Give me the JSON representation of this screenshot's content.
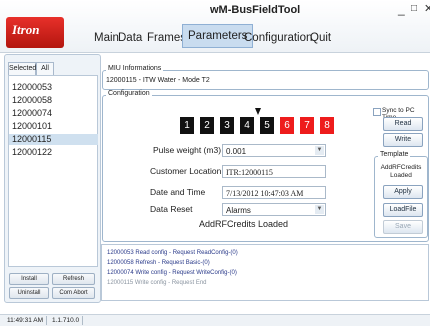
{
  "window": {
    "title": "wM-BusFieldTool",
    "minimize": "_",
    "maximize": "□",
    "close": "✕"
  },
  "brand": {
    "logo_text": "Itron"
  },
  "nav": {
    "items": [
      "Main",
      "Data",
      "Frames",
      "Parameters",
      "Configuration",
      "Quit"
    ],
    "active": "Parameters"
  },
  "left": {
    "tabs": [
      "Selected",
      "All"
    ],
    "devices": [
      "12000053",
      "12000058",
      "12000074",
      "12000101",
      "12000115",
      "12000122"
    ],
    "selected_device": "12000115",
    "buttons": {
      "install": "Install",
      "refresh": "Refresh",
      "uninstall": "Uninstall",
      "com_abort": "Com Abort"
    }
  },
  "miu": {
    "legend": "MIU Informations",
    "text": "12000115 - ITW Water - Mode T2"
  },
  "config": {
    "legend": "Configuration",
    "digits": [
      {
        "value": "1",
        "color": "#111111"
      },
      {
        "value": "2",
        "color": "#111111"
      },
      {
        "value": "3",
        "color": "#111111"
      },
      {
        "value": "4",
        "color": "#111111"
      },
      {
        "value": "5",
        "color": "#111111"
      },
      {
        "value": "6",
        "color": "#ee1c1c"
      },
      {
        "value": "7",
        "color": "#ee1c1c"
      },
      {
        "value": "8",
        "color": "#ee1c1c"
      }
    ],
    "pulse_weight_label": "Pulse weight (m3)",
    "pulse_weight_value": "0.001",
    "customer_location_label": "Customer Location",
    "customer_location_value": "ITR:12000115",
    "date_time_label": "Date and Time",
    "date_time_value": "7/13/2012 10:47:03 AM",
    "data_reset_label": "Data Reset",
    "data_reset_value": "Alarms",
    "status_message": "AddRFCredits  Loaded",
    "sync_label": "Sync to PC Time",
    "read_button": "Read",
    "write_button": "Write"
  },
  "template": {
    "legend": "Template",
    "status": "AddRFCredits Loaded",
    "apply_button": "Apply",
    "loadfile_button": "LoadFile",
    "save_button": "Save"
  },
  "log": [
    {
      "text": "12000053 Read config    - Request ReadConfig-(0)",
      "style": "blue"
    },
    {
      "text": "12000058 Refresh     - Request Basic-(0)",
      "style": "blue"
    },
    {
      "text": "12000074 Write config   - Request WriteConfig-(0)",
      "style": "blue"
    },
    {
      "text": "12000115 Write config   - Request End",
      "style": "gray"
    }
  ],
  "status_bar": {
    "time": "11:49:31 AM",
    "version": "1.1.710.0"
  }
}
